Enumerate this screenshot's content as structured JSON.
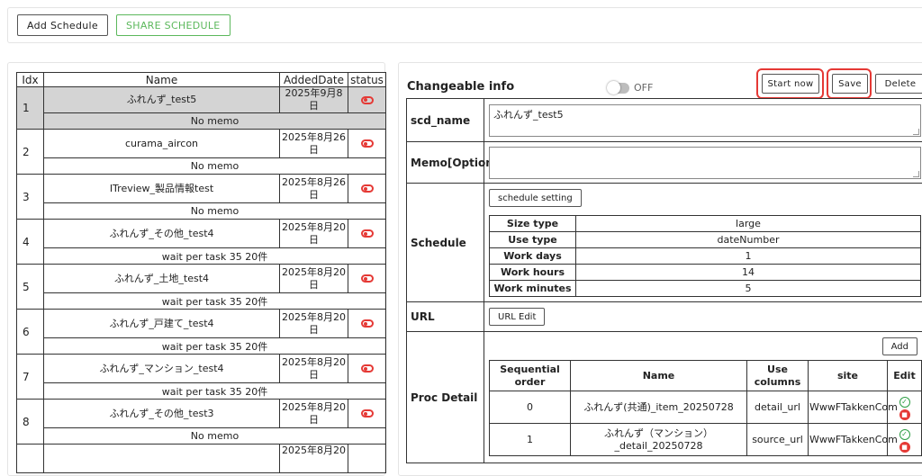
{
  "toolbar": {
    "add_schedule": "Add Schedule",
    "share_schedule": "SHARE SCHEDULE"
  },
  "schedule_table": {
    "headers": [
      "Idx",
      "Name",
      "AddedDate",
      "status"
    ],
    "rows": [
      {
        "idx": "1",
        "name": "ふれんず_test5",
        "date": "2025年9月8日",
        "memo": "No memo"
      },
      {
        "idx": "2",
        "name": "curama_aircon",
        "date": "2025年8月26日",
        "memo": "No memo"
      },
      {
        "idx": "3",
        "name": "ITreview_製品情報test",
        "date": "2025年8月26日",
        "memo": "No memo"
      },
      {
        "idx": "4",
        "name": "ふれんず_その他_test4",
        "date": "2025年8月20日",
        "memo": "wait per task 35 20件"
      },
      {
        "idx": "5",
        "name": "ふれんず_土地_test4",
        "date": "2025年8月20日",
        "memo": "wait per task 35 20件"
      },
      {
        "idx": "6",
        "name": "ふれんず_戸建て_test4",
        "date": "2025年8月20日",
        "memo": "wait per task 35 20件"
      },
      {
        "idx": "7",
        "name": "ふれんず_マンション_test4",
        "date": "2025年8月20日",
        "memo": "wait per task 35 20件"
      },
      {
        "idx": "8",
        "name": "ふれんず_その他_test3",
        "date": "2025年8月20日",
        "memo": "No memo"
      },
      {
        "idx": "",
        "name": "",
        "date": "2025年8月20",
        "memo": ""
      }
    ]
  },
  "info": {
    "title": "Changeable info",
    "toggle_label": "OFF",
    "start_now": "Start now",
    "save": "Save",
    "delete": "Delete",
    "scd_name_label": "scd_name",
    "scd_name_value": "ふれんず_test5",
    "memo_label": "Memo[Option]",
    "memo_value": "",
    "schedule_label": "Schedule",
    "schedule_setting": "schedule setting",
    "schedule_rows": [
      {
        "key": "Size type",
        "value": "large"
      },
      {
        "key": "Use type",
        "value": "dateNumber"
      },
      {
        "key": "Work days",
        "value": "1"
      },
      {
        "key": "Work hours",
        "value": "14"
      },
      {
        "key": "Work minutes",
        "value": "5"
      }
    ],
    "url_label": "URL",
    "url_edit": "URL Edit",
    "proc_label": "Proc Detail",
    "add": "Add",
    "proc_headers": [
      "Sequential order",
      "Name",
      "Use columns",
      "site",
      "Edit"
    ],
    "proc_rows": [
      {
        "order": "0",
        "name": "ふれんず(共通)_item_20250728",
        "columns": "detail_url",
        "site": "WwwFTakkenCom"
      },
      {
        "order": "1",
        "name": "ふれんず（マンション）_detail_20250728",
        "columns": "source_url",
        "site": "WwwFTakkenCom"
      }
    ]
  },
  "colors": {
    "accent_green": "#5cb85c",
    "status_red": "#e53935",
    "selected_row": "#d4d4d4"
  }
}
